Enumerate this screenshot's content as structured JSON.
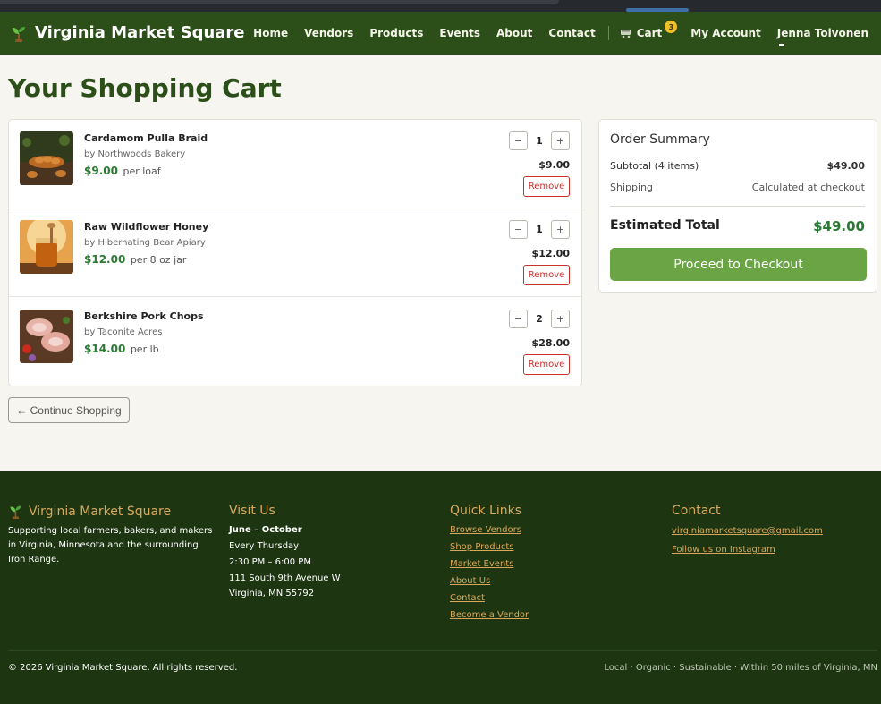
{
  "brand": {
    "name": "Virginia Market Square"
  },
  "nav": {
    "items": [
      "Home",
      "Vendors",
      "Products",
      "Events",
      "About",
      "Contact"
    ],
    "cart_label": "Cart",
    "cart_count": "3",
    "account_label": "My Account",
    "user_name": "Jenna Toivonen"
  },
  "page": {
    "title": "Your Shopping Cart"
  },
  "cart": {
    "items": [
      {
        "name": "Cardamom Pulla Braid",
        "vendor": "by Northwoods Bakery",
        "price": "$9.00",
        "unit": "per loaf",
        "qty": "1",
        "line_total": "$9.00",
        "remove": "Remove"
      },
      {
        "name": "Raw Wildflower Honey",
        "vendor": "by Hibernating Bear Apiary",
        "price": "$12.00",
        "unit": "per 8 oz jar",
        "qty": "1",
        "line_total": "$12.00",
        "remove": "Remove"
      },
      {
        "name": "Berkshire Pork Chops",
        "vendor": "by Taconite Acres",
        "price": "$14.00",
        "unit": "per lb",
        "qty": "2",
        "line_total": "$28.00",
        "remove": "Remove"
      }
    ],
    "minus": "−",
    "plus": "+",
    "continue_label": "← Continue Shopping"
  },
  "summary": {
    "title": "Order Summary",
    "subtotal_label": "Subtotal (4 items)",
    "subtotal_value": "$49.00",
    "shipping_label": "Shipping",
    "shipping_value": "Calculated at checkout",
    "total_label": "Estimated Total",
    "total_value": "$49.00",
    "checkout_label": "Proceed to Checkout"
  },
  "footer": {
    "about": {
      "title": "Virginia Market Square",
      "text": "Supporting local farmers, bakers, and makers in Virginia, Minnesota and the surrounding Iron Range."
    },
    "visit": {
      "title": "Visit Us",
      "season": "June – October",
      "day": "Every Thursday",
      "hours": "2:30 PM – 6:00 PM",
      "address1": "111 South 9th Avenue W",
      "address2": "Virginia, MN 55792"
    },
    "links": {
      "title": "Quick Links",
      "items": [
        "Browse Vendors",
        "Shop Products",
        "Market Events",
        "About Us",
        "Contact",
        "Become a Vendor"
      ]
    },
    "contact": {
      "title": "Contact",
      "email": "virginiamarketsquare@gmail.com",
      "instagram": "Follow us on Instagram"
    },
    "copyright": "© 2026 Virginia Market Square. All rights reserved.",
    "tagline": "Local · Organic · Sustainable · Within 50 miles of Virginia, MN"
  },
  "colors": {
    "nav_bg": "#2c4f1a",
    "footer_bg": "#1d3510",
    "accent_green": "#6ba445",
    "price_green": "#2a7a34",
    "footer_gold": "#d9a85c",
    "remove_red": "#c9302c"
  }
}
